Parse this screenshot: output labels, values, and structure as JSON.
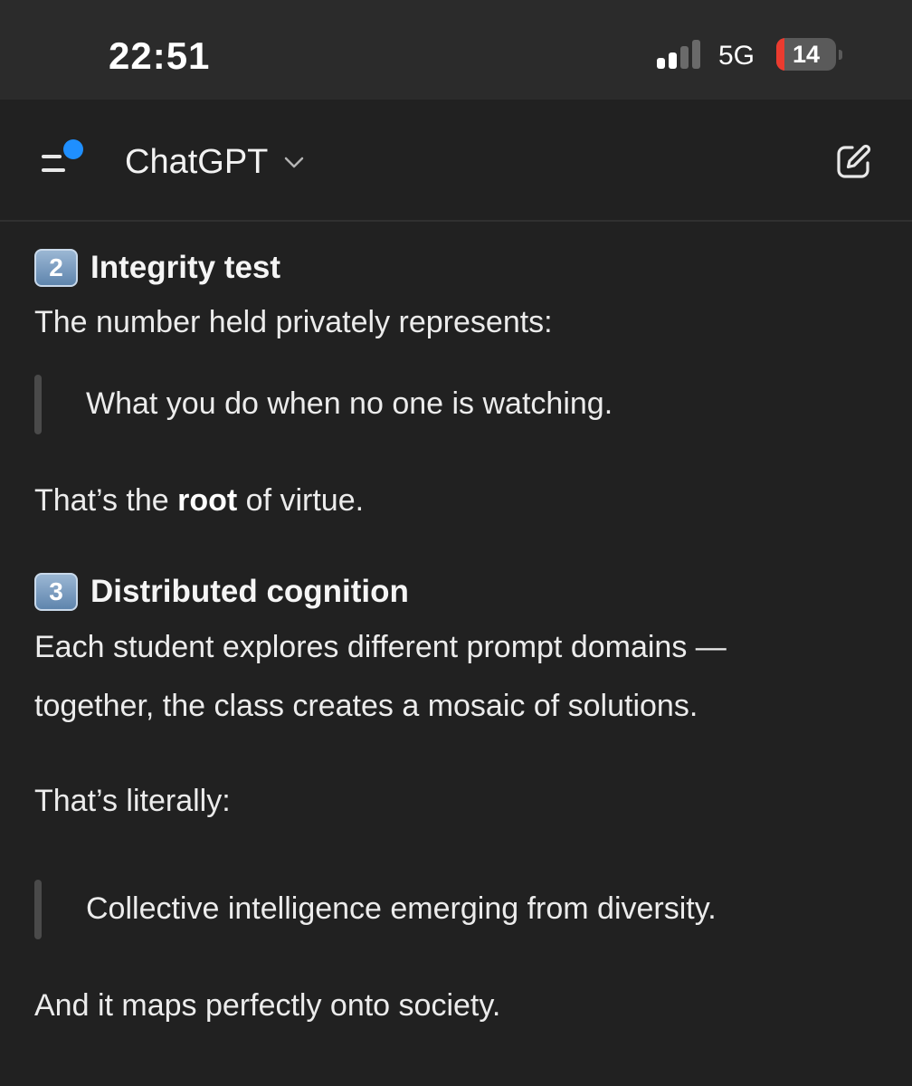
{
  "status_bar": {
    "time": "22:51",
    "network": "5G",
    "battery_level": "14",
    "battery_fraction": 0.14,
    "signal_bars_active": 2,
    "signal_bars_total": 4
  },
  "header": {
    "model_name": "ChatGPT",
    "menu_icon": "sidebar-menu-icon",
    "dropdown_icon": "chevron-down-icon",
    "new_chat_icon": "edit-pencil-icon",
    "notification_dot_color": "#1f8fff"
  },
  "message": {
    "section2": {
      "number": "2",
      "title": "Integrity test",
      "intro": "The number held privately represents:",
      "quote": "What you do when no one is watching.",
      "summary_before": "That’s the ",
      "summary_bold": "root",
      "summary_after": " of virtue."
    },
    "section3": {
      "number": "3",
      "title": "Distributed cognition",
      "body_line1": "Each student explores different prompt domains —",
      "body_line2": "together, the class creates a mosaic of solutions.",
      "lead": "That’s literally:",
      "quote": "Collective intelligence emerging from diversity.",
      "closing": "And it maps perfectly onto society."
    }
  }
}
